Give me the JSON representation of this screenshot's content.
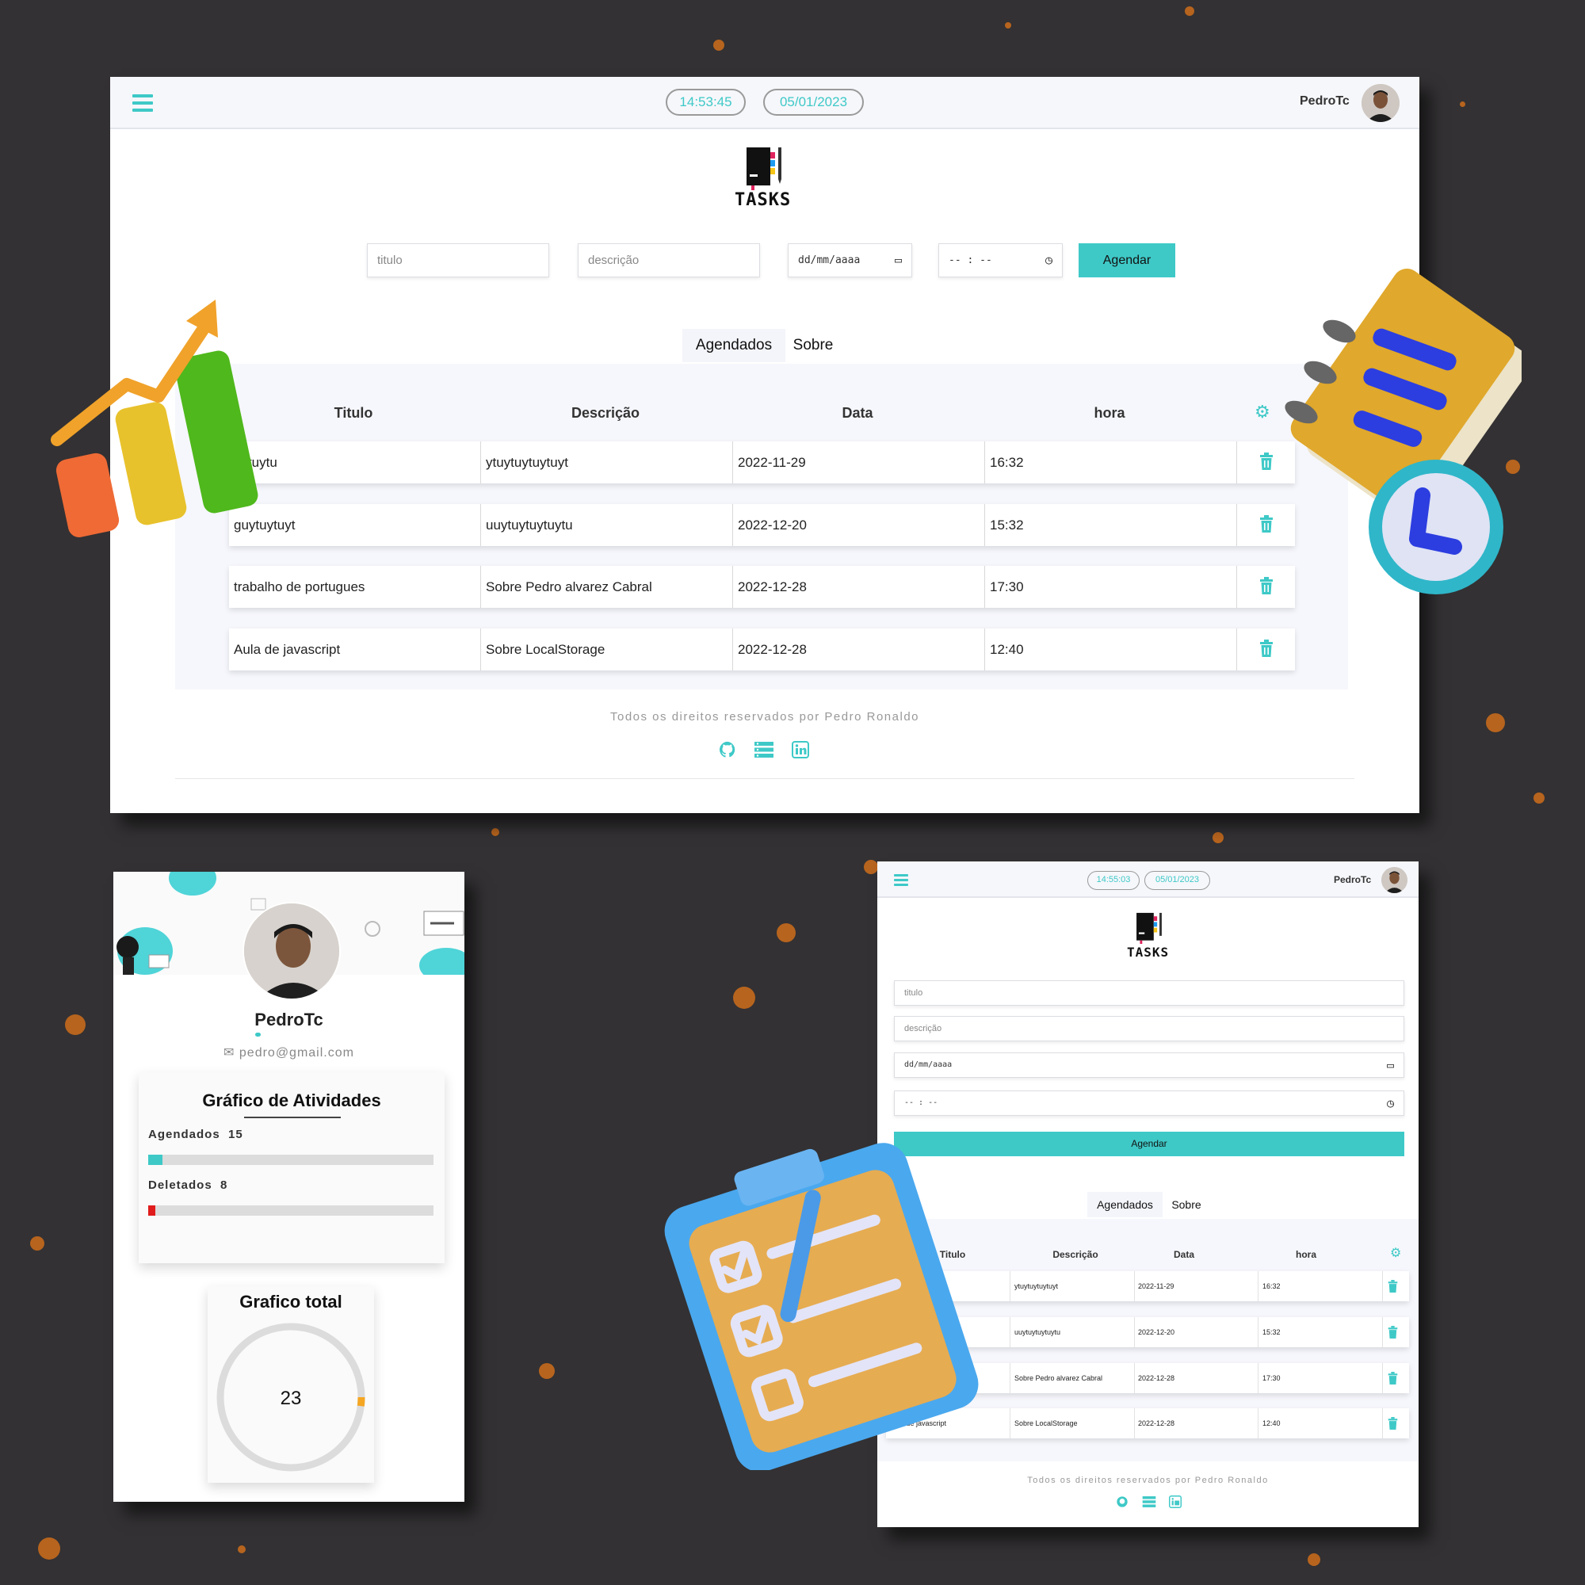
{
  "colors": {
    "accent": "#3ec9c7",
    "danger": "#e01c1c",
    "donut_track": "#dcdcdc",
    "donut_arc": "#f5a623"
  },
  "desktop": {
    "time": "14:53:45",
    "date": "05/01/2023",
    "user": "PedroTc",
    "logo_text": "TASKS",
    "form": {
      "title_placeholder": "titulo",
      "desc_placeholder": "descrição",
      "date_placeholder": "dd/mm/aaaa",
      "time_placeholder": "-- : --",
      "submit_label": "Agendar"
    },
    "tabs": [
      "Agendados",
      "Sobre"
    ],
    "table": {
      "headers": [
        "Titulo",
        "Descrição",
        "Data",
        "hora"
      ],
      "rows": [
        [
          "uytuytu",
          "ytuytuytuytuyt",
          "2022-11-29",
          "16:32"
        ],
        [
          "guytuytuyt",
          "uuytuytuytuytu",
          "2022-12-20",
          "15:32"
        ],
        [
          "trabalho de portugues",
          "Sobre Pedro alvarez Cabral",
          "2022-12-28",
          "17:30"
        ],
        [
          "Aula de javascript",
          "Sobre LocalStorage",
          "2022-12-28",
          "12:40"
        ]
      ]
    },
    "footer": "Todos os direitos reservados por Pedro Ronaldo",
    "social_icons": [
      "github-icon",
      "server-icon",
      "linkedin-icon"
    ]
  },
  "profile": {
    "name": "PedroTc",
    "email": "pedro@gmail.com",
    "activity_title": "Gráfico de Atividades",
    "stats": [
      {
        "label": "Agendados",
        "value": "15",
        "fraction": 0.05,
        "color": "#3ec9c7"
      },
      {
        "label": "Deletados",
        "value": "8",
        "fraction": 0.025,
        "color": "#e01c1c"
      }
    ],
    "total_title": "Grafico total",
    "total_value": "23",
    "arc_fraction": 0.04
  },
  "mobile": {
    "time": "14:55:03",
    "date": "05/01/2023",
    "user": "PedroTc",
    "logo_text": "TASKS",
    "form": {
      "title_placeholder": "titulo",
      "desc_placeholder": "descrição",
      "date_placeholder": "dd/mm/aaaa",
      "time_placeholder": "-- : --",
      "submit_label": "Agendar"
    },
    "tabs": [
      "Agendados",
      "Sobre"
    ],
    "table": {
      "headers": [
        "Titulo",
        "Descrição",
        "Data",
        "hora"
      ],
      "rows": [
        [
          "",
          "ytuytuytuytuyt",
          "2022-11-29",
          "16:32"
        ],
        [
          "",
          "uuytuytuytuytu",
          "2022-12-20",
          "15:32"
        ],
        [
          "...rtugues",
          "Sobre Pedro alvarez Cabral",
          "2022-12-28",
          "17:30"
        ],
        [
          "Aula de javascript",
          "Sobre LocalStorage",
          "2022-12-28",
          "12:40"
        ]
      ]
    },
    "footer": "Todos os direitos reservados por Pedro Ronaldo"
  }
}
